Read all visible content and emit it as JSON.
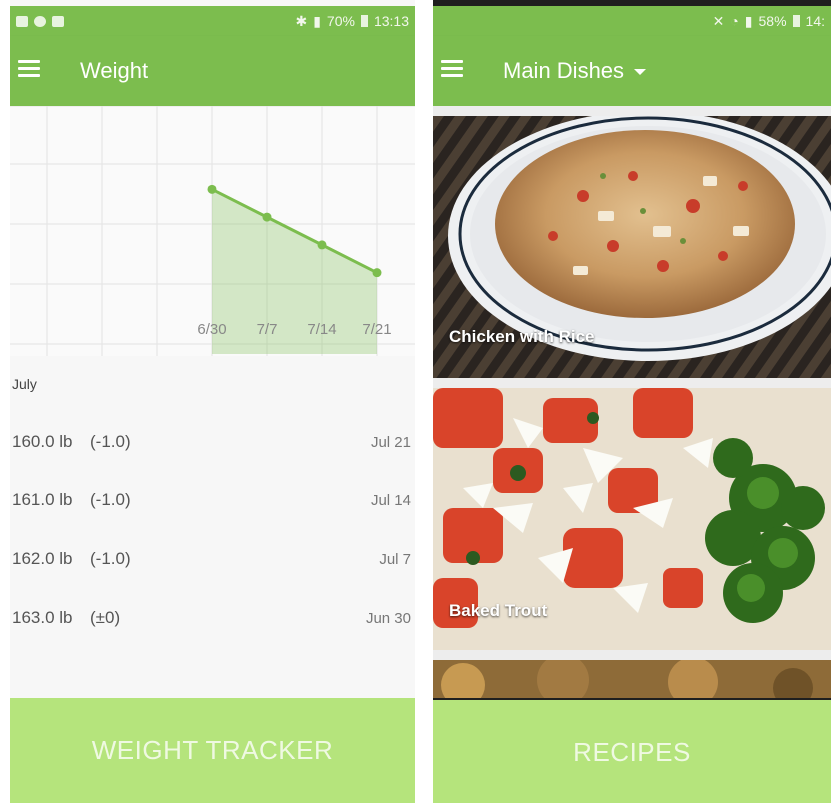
{
  "left": {
    "status": {
      "battery": "70%",
      "time": "13:13"
    },
    "title": "Weight",
    "chart_data": {
      "type": "area",
      "categories": [
        "6/30",
        "7/7",
        "7/14",
        "7/21"
      ],
      "values": [
        163.0,
        162.0,
        161.0,
        160.0
      ],
      "ylim": [
        157,
        166
      ],
      "grid": true,
      "color": "#7cbd4e"
    },
    "month": "July",
    "entries": [
      {
        "weight": "160.0 lb",
        "delta": "(-1.0)",
        "date": "Jul 21"
      },
      {
        "weight": "161.0 lb",
        "delta": "(-1.0)",
        "date": "Jul 14"
      },
      {
        "weight": "162.0 lb",
        "delta": "(-1.0)",
        "date": "Jul 7"
      },
      {
        "weight": "163.0 lb",
        "delta": "(±0)",
        "date": "Jun 30"
      }
    ],
    "button": "WEIGHT TRACKER"
  },
  "right": {
    "status": {
      "battery": "58%",
      "time": "14:"
    },
    "title": "Main Dishes",
    "recipes": [
      {
        "caption": "Chicken with Rice"
      },
      {
        "caption": "Baked Trout"
      }
    ],
    "button": "RECIPES"
  },
  "colors": {
    "primary": "#7cbd4e",
    "button": "#b5e47c"
  }
}
